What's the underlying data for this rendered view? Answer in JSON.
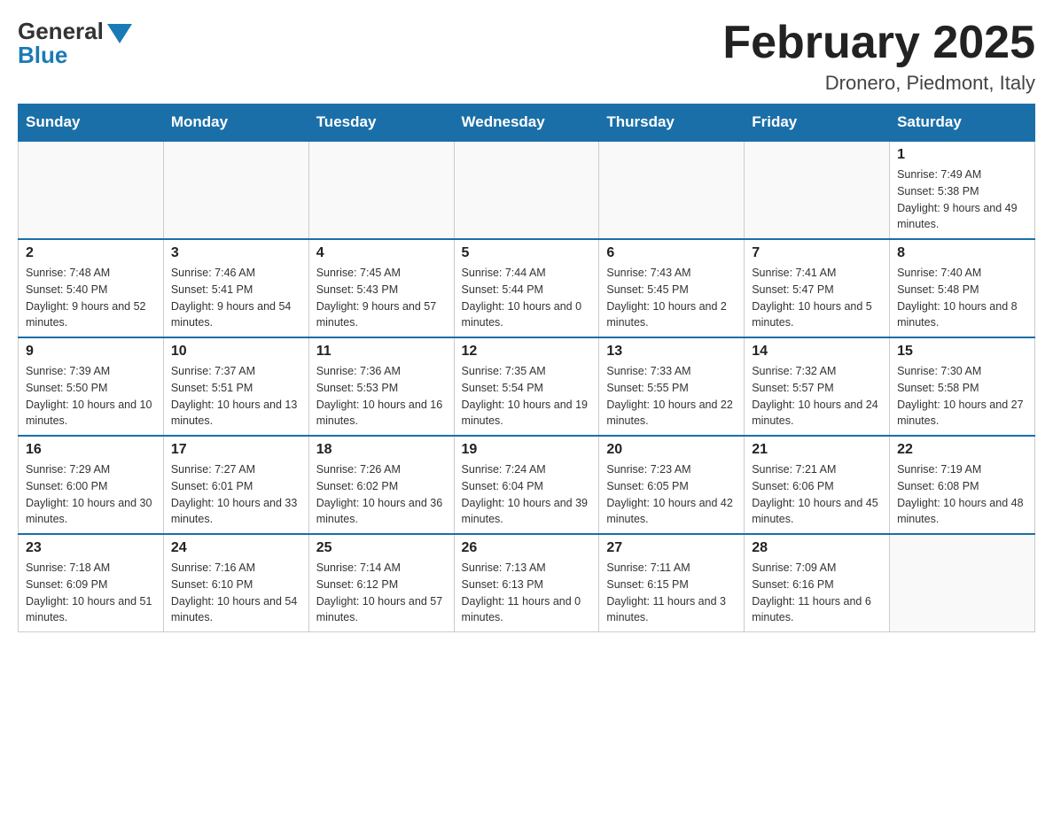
{
  "header": {
    "logo": {
      "general": "General",
      "blue": "Blue"
    },
    "title": "February 2025",
    "location": "Dronero, Piedmont, Italy"
  },
  "days_of_week": [
    "Sunday",
    "Monday",
    "Tuesday",
    "Wednesday",
    "Thursday",
    "Friday",
    "Saturday"
  ],
  "weeks": [
    [
      {
        "day": "",
        "info": ""
      },
      {
        "day": "",
        "info": ""
      },
      {
        "day": "",
        "info": ""
      },
      {
        "day": "",
        "info": ""
      },
      {
        "day": "",
        "info": ""
      },
      {
        "day": "",
        "info": ""
      },
      {
        "day": "1",
        "info": "Sunrise: 7:49 AM\nSunset: 5:38 PM\nDaylight: 9 hours and 49 minutes."
      }
    ],
    [
      {
        "day": "2",
        "info": "Sunrise: 7:48 AM\nSunset: 5:40 PM\nDaylight: 9 hours and 52 minutes."
      },
      {
        "day": "3",
        "info": "Sunrise: 7:46 AM\nSunset: 5:41 PM\nDaylight: 9 hours and 54 minutes."
      },
      {
        "day": "4",
        "info": "Sunrise: 7:45 AM\nSunset: 5:43 PM\nDaylight: 9 hours and 57 minutes."
      },
      {
        "day": "5",
        "info": "Sunrise: 7:44 AM\nSunset: 5:44 PM\nDaylight: 10 hours and 0 minutes."
      },
      {
        "day": "6",
        "info": "Sunrise: 7:43 AM\nSunset: 5:45 PM\nDaylight: 10 hours and 2 minutes."
      },
      {
        "day": "7",
        "info": "Sunrise: 7:41 AM\nSunset: 5:47 PM\nDaylight: 10 hours and 5 minutes."
      },
      {
        "day": "8",
        "info": "Sunrise: 7:40 AM\nSunset: 5:48 PM\nDaylight: 10 hours and 8 minutes."
      }
    ],
    [
      {
        "day": "9",
        "info": "Sunrise: 7:39 AM\nSunset: 5:50 PM\nDaylight: 10 hours and 10 minutes."
      },
      {
        "day": "10",
        "info": "Sunrise: 7:37 AM\nSunset: 5:51 PM\nDaylight: 10 hours and 13 minutes."
      },
      {
        "day": "11",
        "info": "Sunrise: 7:36 AM\nSunset: 5:53 PM\nDaylight: 10 hours and 16 minutes."
      },
      {
        "day": "12",
        "info": "Sunrise: 7:35 AM\nSunset: 5:54 PM\nDaylight: 10 hours and 19 minutes."
      },
      {
        "day": "13",
        "info": "Sunrise: 7:33 AM\nSunset: 5:55 PM\nDaylight: 10 hours and 22 minutes."
      },
      {
        "day": "14",
        "info": "Sunrise: 7:32 AM\nSunset: 5:57 PM\nDaylight: 10 hours and 24 minutes."
      },
      {
        "day": "15",
        "info": "Sunrise: 7:30 AM\nSunset: 5:58 PM\nDaylight: 10 hours and 27 minutes."
      }
    ],
    [
      {
        "day": "16",
        "info": "Sunrise: 7:29 AM\nSunset: 6:00 PM\nDaylight: 10 hours and 30 minutes."
      },
      {
        "day": "17",
        "info": "Sunrise: 7:27 AM\nSunset: 6:01 PM\nDaylight: 10 hours and 33 minutes."
      },
      {
        "day": "18",
        "info": "Sunrise: 7:26 AM\nSunset: 6:02 PM\nDaylight: 10 hours and 36 minutes."
      },
      {
        "day": "19",
        "info": "Sunrise: 7:24 AM\nSunset: 6:04 PM\nDaylight: 10 hours and 39 minutes."
      },
      {
        "day": "20",
        "info": "Sunrise: 7:23 AM\nSunset: 6:05 PM\nDaylight: 10 hours and 42 minutes."
      },
      {
        "day": "21",
        "info": "Sunrise: 7:21 AM\nSunset: 6:06 PM\nDaylight: 10 hours and 45 minutes."
      },
      {
        "day": "22",
        "info": "Sunrise: 7:19 AM\nSunset: 6:08 PM\nDaylight: 10 hours and 48 minutes."
      }
    ],
    [
      {
        "day": "23",
        "info": "Sunrise: 7:18 AM\nSunset: 6:09 PM\nDaylight: 10 hours and 51 minutes."
      },
      {
        "day": "24",
        "info": "Sunrise: 7:16 AM\nSunset: 6:10 PM\nDaylight: 10 hours and 54 minutes."
      },
      {
        "day": "25",
        "info": "Sunrise: 7:14 AM\nSunset: 6:12 PM\nDaylight: 10 hours and 57 minutes."
      },
      {
        "day": "26",
        "info": "Sunrise: 7:13 AM\nSunset: 6:13 PM\nDaylight: 11 hours and 0 minutes."
      },
      {
        "day": "27",
        "info": "Sunrise: 7:11 AM\nSunset: 6:15 PM\nDaylight: 11 hours and 3 minutes."
      },
      {
        "day": "28",
        "info": "Sunrise: 7:09 AM\nSunset: 6:16 PM\nDaylight: 11 hours and 6 minutes."
      },
      {
        "day": "",
        "info": ""
      }
    ]
  ]
}
